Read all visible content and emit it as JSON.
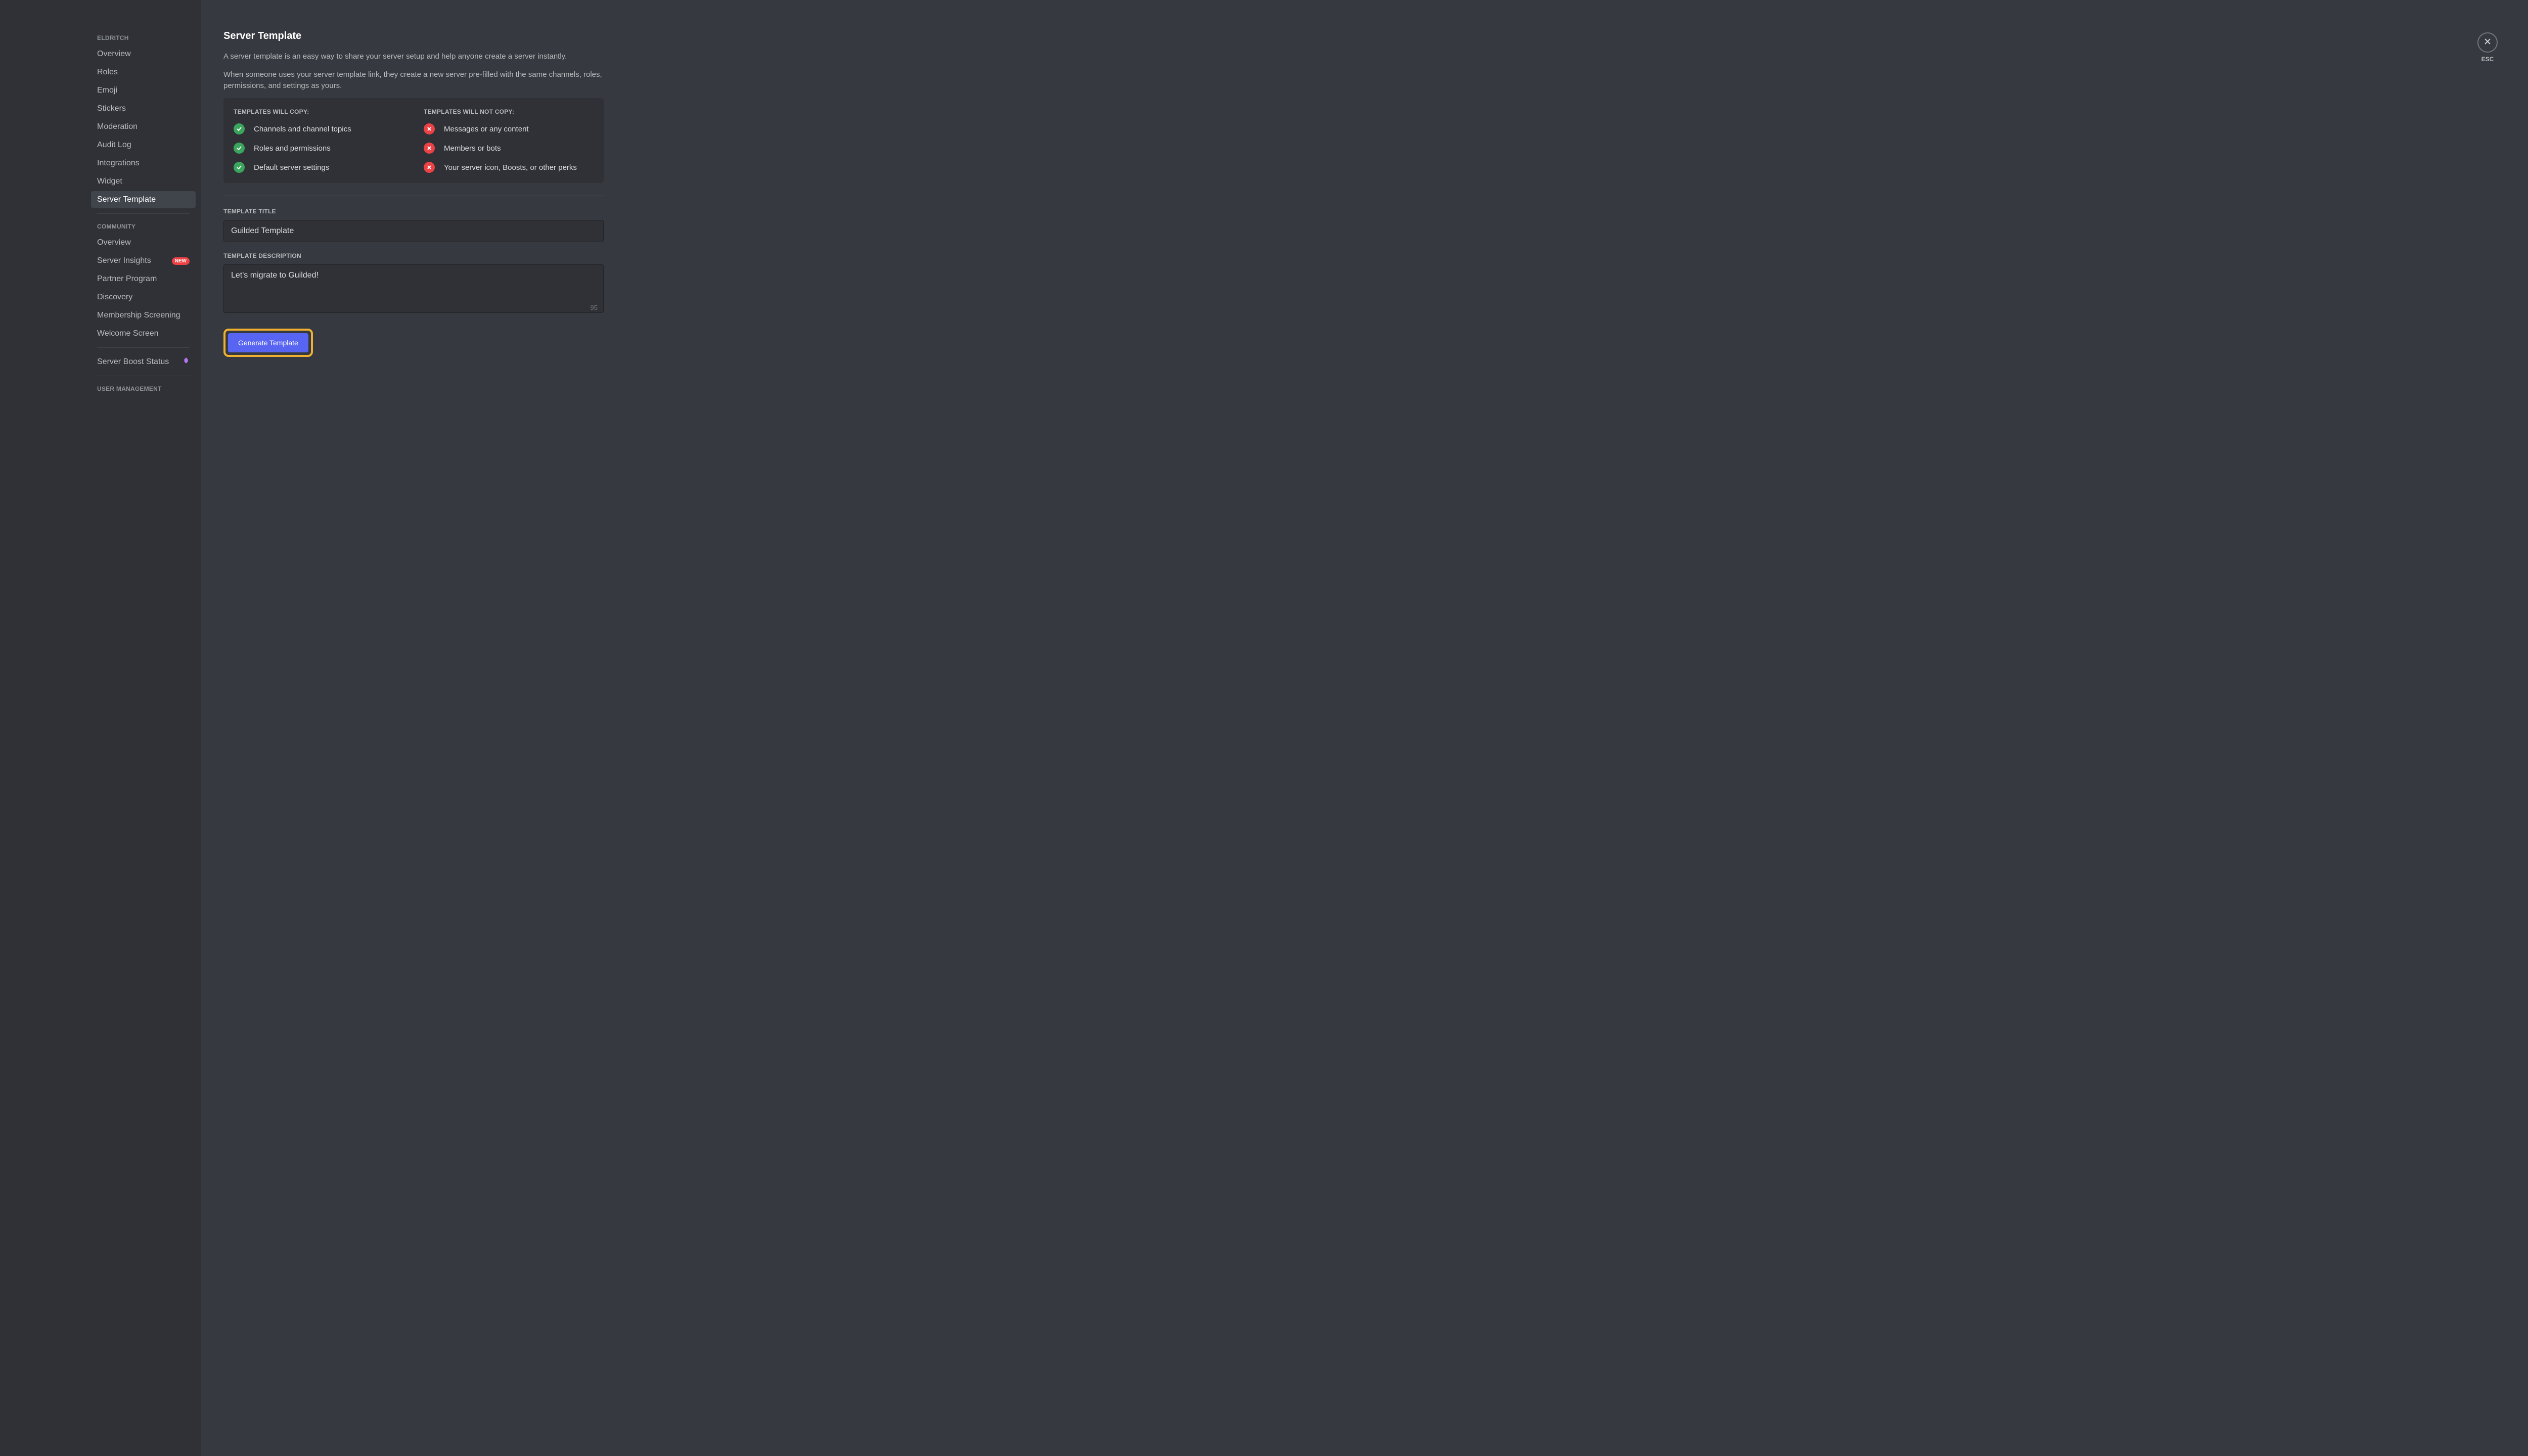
{
  "sidebar": {
    "section1_header": "ELDRITCH",
    "items1": [
      {
        "label": "Overview"
      },
      {
        "label": "Roles"
      },
      {
        "label": "Emoji"
      },
      {
        "label": "Stickers"
      },
      {
        "label": "Moderation"
      },
      {
        "label": "Audit Log"
      },
      {
        "label": "Integrations"
      },
      {
        "label": "Widget"
      },
      {
        "label": "Server Template",
        "selected": true
      }
    ],
    "section2_header": "COMMUNITY",
    "items2": [
      {
        "label": "Overview"
      },
      {
        "label": "Server Insights",
        "badge": "NEW"
      },
      {
        "label": "Partner Program"
      },
      {
        "label": "Discovery"
      },
      {
        "label": "Membership Screening"
      },
      {
        "label": "Welcome Screen"
      }
    ],
    "boost_label": "Server Boost Status",
    "section3_header": "USER MANAGEMENT"
  },
  "main": {
    "title": "Server Template",
    "desc1": "A server template is an easy way to share your server setup and help anyone create a server instantly.",
    "desc2": "When someone uses your server template link, they create a new server pre-filled with the same channels, roles, permissions, and settings as yours.",
    "will_copy_header": "TEMPLATES WILL COPY:",
    "will_copy": [
      "Channels and channel topics",
      "Roles and permissions",
      "Default server settings"
    ],
    "wont_copy_header": "TEMPLATES WILL NOT COPY:",
    "wont_copy": [
      "Messages or any content",
      "Members or bots",
      "Your server icon, Boosts, or other perks"
    ],
    "title_label": "TEMPLATE TITLE",
    "title_value": "Guilded Template",
    "desc_label": "TEMPLATE DESCRIPTION",
    "desc_value": "Let's migrate to Guilded!",
    "char_count": "95",
    "generate_label": "Generate Template"
  },
  "close": {
    "label": "ESC"
  }
}
